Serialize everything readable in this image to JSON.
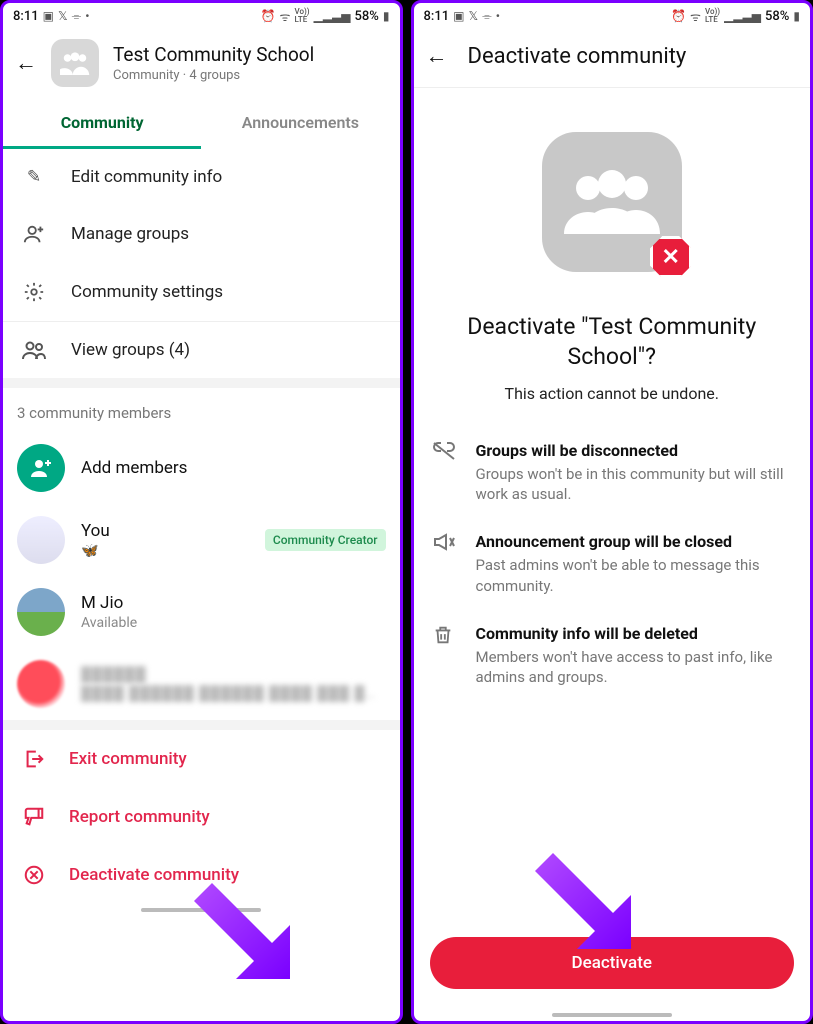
{
  "status": {
    "time": "8:11",
    "battery": "58%"
  },
  "left": {
    "header": {
      "title": "Test Community School",
      "subtitle": "Community · 4 groups"
    },
    "tabs": {
      "community": "Community",
      "announcements": "Announcements"
    },
    "rows": {
      "edit": "Edit community info",
      "manage": "Manage groups",
      "settings": "Community settings",
      "viewgroups": "View groups (4)"
    },
    "members_header": "3 community members",
    "add_members": "Add members",
    "you": {
      "name": "You",
      "emoji": "🦋",
      "badge": "Community Creator"
    },
    "mjio": {
      "name": "M Jio",
      "status": "Available"
    },
    "blurred": {
      "name": "██████",
      "status": "████ ██████ ██████ ████ ███ ███…"
    },
    "actions": {
      "exit": "Exit community",
      "report": "Report community",
      "deactivate": "Deactivate community"
    }
  },
  "right": {
    "header": "Deactivate community",
    "title": "Deactivate \"Test Community School\"?",
    "subtitle": "This action cannot be undone.",
    "bullets": [
      {
        "title": "Groups will be disconnected",
        "desc": "Groups won't be in this community but will still work as usual."
      },
      {
        "title": "Announcement group will be closed",
        "desc": "Past admins won't be able to message this community."
      },
      {
        "title": "Community info will be deleted",
        "desc": "Members won't have access to past info, like admins and groups."
      }
    ],
    "button": "Deactivate"
  }
}
